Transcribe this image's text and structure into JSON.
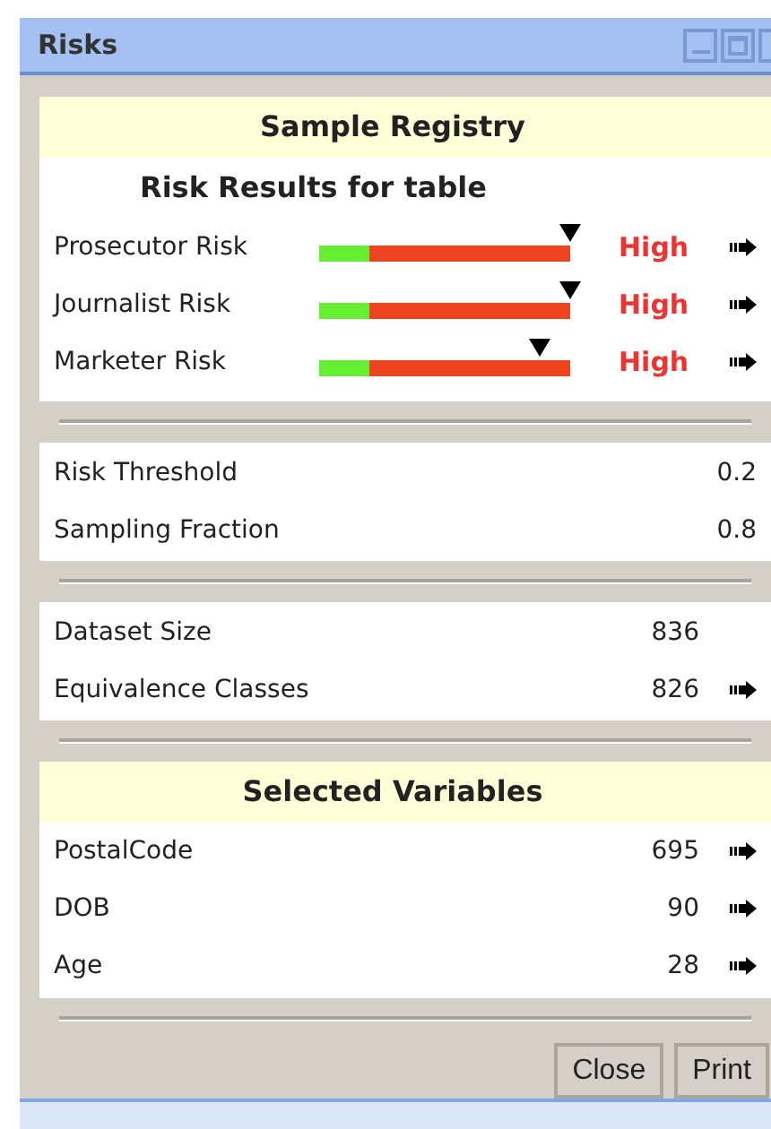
{
  "window": {
    "title": "Risks"
  },
  "registry": {
    "title": "Sample Registry",
    "subtitle": "Risk Results for table",
    "risks": [
      {
        "label": "Prosecutor Risk",
        "level": 1.0,
        "result": "High"
      },
      {
        "label": "Journalist Risk",
        "level": 1.0,
        "result": "High"
      },
      {
        "label": "Marketer Risk",
        "level": 0.88,
        "result": "High"
      }
    ]
  },
  "settings": [
    {
      "label": "Risk Threshold",
      "value": "0.2"
    },
    {
      "label": "Sampling Fraction",
      "value": "0.8"
    }
  ],
  "dataset": [
    {
      "label": "Dataset Size",
      "value": "836",
      "arrow": false
    },
    {
      "label": "Equivalence Classes",
      "value": "826",
      "arrow": true
    }
  ],
  "variables": {
    "title": "Selected Variables",
    "rows": [
      {
        "label": "PostalCode",
        "value": "695",
        "arrow": true
      },
      {
        "label": "DOB",
        "value": "90",
        "arrow": true
      },
      {
        "label": "Age",
        "value": "28",
        "arrow": true
      }
    ]
  },
  "buttons": [
    "Close",
    "Print"
  ]
}
